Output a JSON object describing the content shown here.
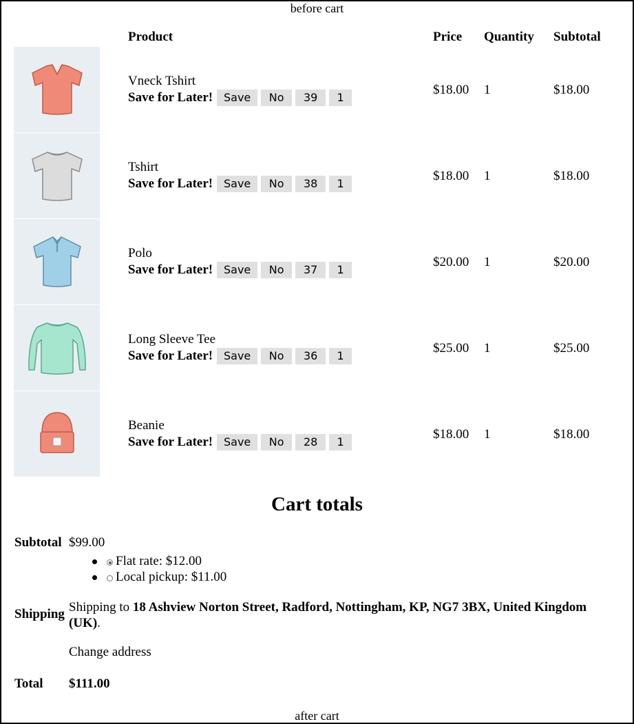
{
  "hooks": {
    "before": "before cart",
    "after": "after cart"
  },
  "table": {
    "headers": {
      "product": "Product",
      "price": "Price",
      "quantity": "Quantity",
      "subtotal": "Subtotal"
    },
    "save_label": "Save for Later!",
    "items": [
      {
        "name": "Vneck Tshirt",
        "save_btn": "Save",
        "no_btn": "No",
        "id": "39",
        "qty_btn": "1",
        "price": "$18.00",
        "quantity": "1",
        "subtotal": "$18.00",
        "image": "vneck-tshirt-icon",
        "color": "#f08a78"
      },
      {
        "name": "Tshirt",
        "save_btn": "Save",
        "no_btn": "No",
        "id": "38",
        "qty_btn": "1",
        "price": "$18.00",
        "quantity": "1",
        "subtotal": "$18.00",
        "image": "tshirt-icon",
        "color": "#dcdcdc"
      },
      {
        "name": "Polo",
        "save_btn": "Save",
        "no_btn": "No",
        "id": "37",
        "qty_btn": "1",
        "price": "$20.00",
        "quantity": "1",
        "subtotal": "$20.00",
        "image": "polo-icon",
        "color": "#9fd0e8"
      },
      {
        "name": "Long Sleeve Tee",
        "save_btn": "Save",
        "no_btn": "No",
        "id": "36",
        "qty_btn": "1",
        "price": "$25.00",
        "quantity": "1",
        "subtotal": "$25.00",
        "image": "long-sleeve-tee-icon",
        "color": "#a6e6cf"
      },
      {
        "name": "Beanie",
        "save_btn": "Save",
        "no_btn": "No",
        "id": "28",
        "qty_btn": "1",
        "price": "$18.00",
        "quantity": "1",
        "subtotal": "$18.00",
        "image": "beanie-icon",
        "color": "#f08a78"
      }
    ]
  },
  "totals": {
    "title": "Cart totals",
    "subtotal_label": "Subtotal",
    "subtotal_value": "$99.00",
    "shipping_options": [
      {
        "label": "Flat rate: $12.00",
        "selected": true
      },
      {
        "label": "Local pickup: $11.00",
        "selected": false
      }
    ],
    "shipping_label": "Shipping",
    "shipping_to_prefix": "Shipping to",
    "shipping_address": "18 Ashview Norton Street, Radford, Nottingham, KP, NG7 3BX, United Kingdom (UK)",
    "shipping_suffix": ".",
    "change_address": "Change address",
    "total_label": "Total",
    "total_value": "$111.00"
  }
}
